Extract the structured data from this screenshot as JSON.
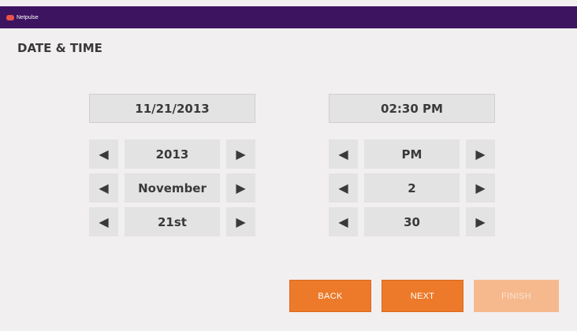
{
  "app": {
    "brand": "Netpulse"
  },
  "page": {
    "title": "DATE & TIME"
  },
  "date": {
    "display": "11/21/2013",
    "year": "2013",
    "month": "November",
    "day": "21st"
  },
  "time": {
    "display": "02:30 PM",
    "ampm": "PM",
    "hour": "2",
    "minute": "30"
  },
  "icons": {
    "left": "◀",
    "right": "▶"
  },
  "buttons": {
    "back": "BACK",
    "next": "NEXT",
    "finish": "FINISH"
  },
  "colors": {
    "header": "#3d1460",
    "accent": "#ec7a2a",
    "disabled": "#f6b98e"
  }
}
